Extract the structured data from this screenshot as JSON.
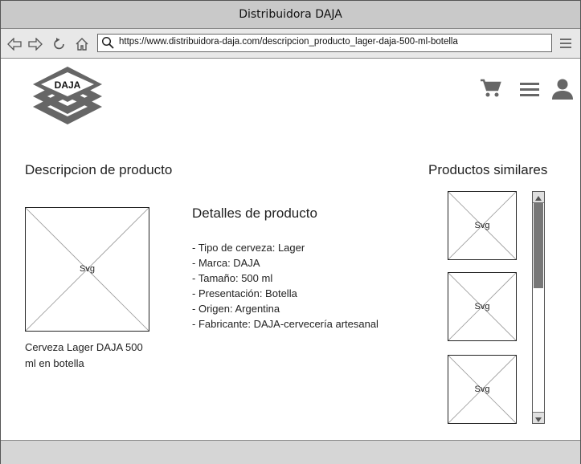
{
  "window": {
    "title": "Distribuidora DAJA"
  },
  "browser": {
    "url": "https://www.distribuidora-daja.com/descripcion_producto_lager-daja-500-ml-botella",
    "icons": [
      "back-arrow-icon",
      "forward-arrow-icon",
      "reload-icon",
      "home-icon",
      "search-icon",
      "hamburger-menu-icon"
    ]
  },
  "header": {
    "logo_text": "DAJA",
    "icons": [
      "cart-icon",
      "hamburger-menu-icon",
      "user-icon"
    ]
  },
  "main": {
    "title": "Descripcion de producto",
    "image_label": "Svg",
    "product_name": "Cerveza Lager DAJA 500 ml en botella",
    "details_title": "Detalles de producto",
    "details": [
      "Tipo de cerveza: Lager",
      "Marca: DAJA",
      "Tamaño: 500 ml",
      "Presentación: Botella",
      "Origen: Argentina",
      "Fabricante: DAJA-cervecería artesanal"
    ]
  },
  "similar": {
    "title": "Productos similares",
    "items": [
      {
        "label": "Svg"
      },
      {
        "label": "Svg"
      },
      {
        "label": "Svg"
      }
    ],
    "scroll_position": 0.05
  },
  "colors": {
    "titlebar": "#c9c9c9",
    "toolbar": "#e8e8e8",
    "icon_gray": "#666666"
  }
}
